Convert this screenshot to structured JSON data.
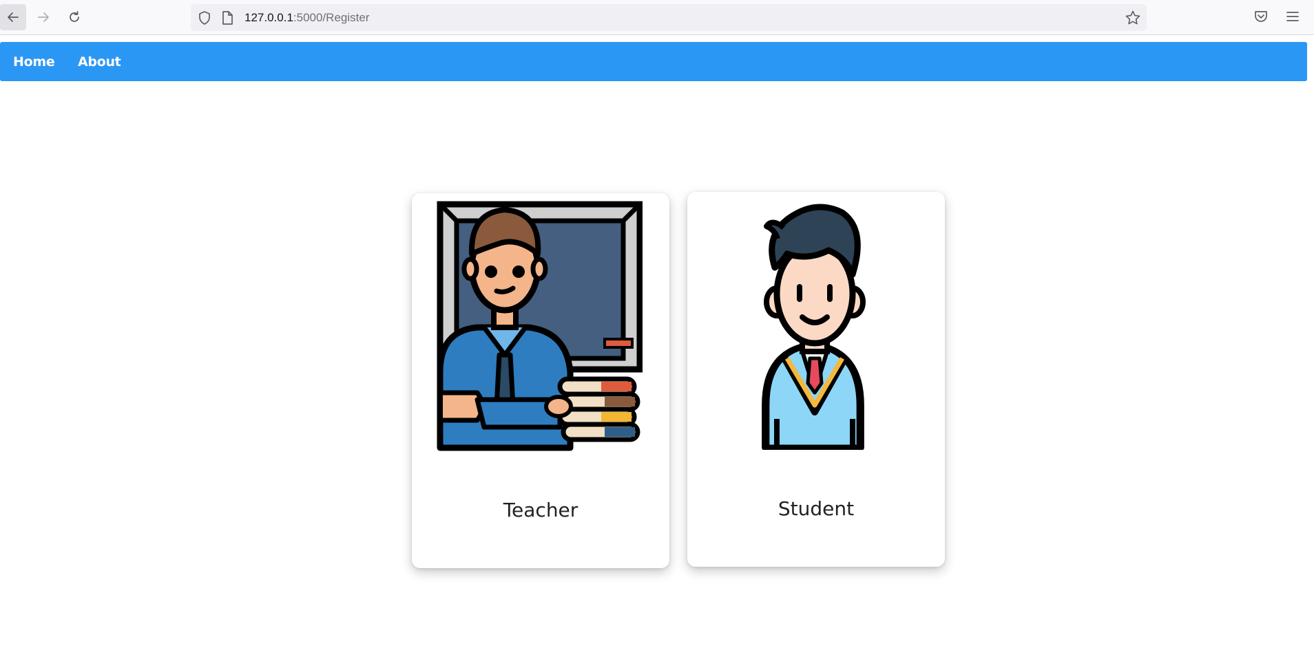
{
  "browser": {
    "url_host": "127.0.0.1",
    "url_rest": ":5000/Register"
  },
  "nav": {
    "home_label": "Home",
    "about_label": "About",
    "background_color": "#2b97f5"
  },
  "cards": [
    {
      "label": "Teacher",
      "icon": "teacher-illustration"
    },
    {
      "label": "Student",
      "icon": "student-illustration"
    }
  ]
}
